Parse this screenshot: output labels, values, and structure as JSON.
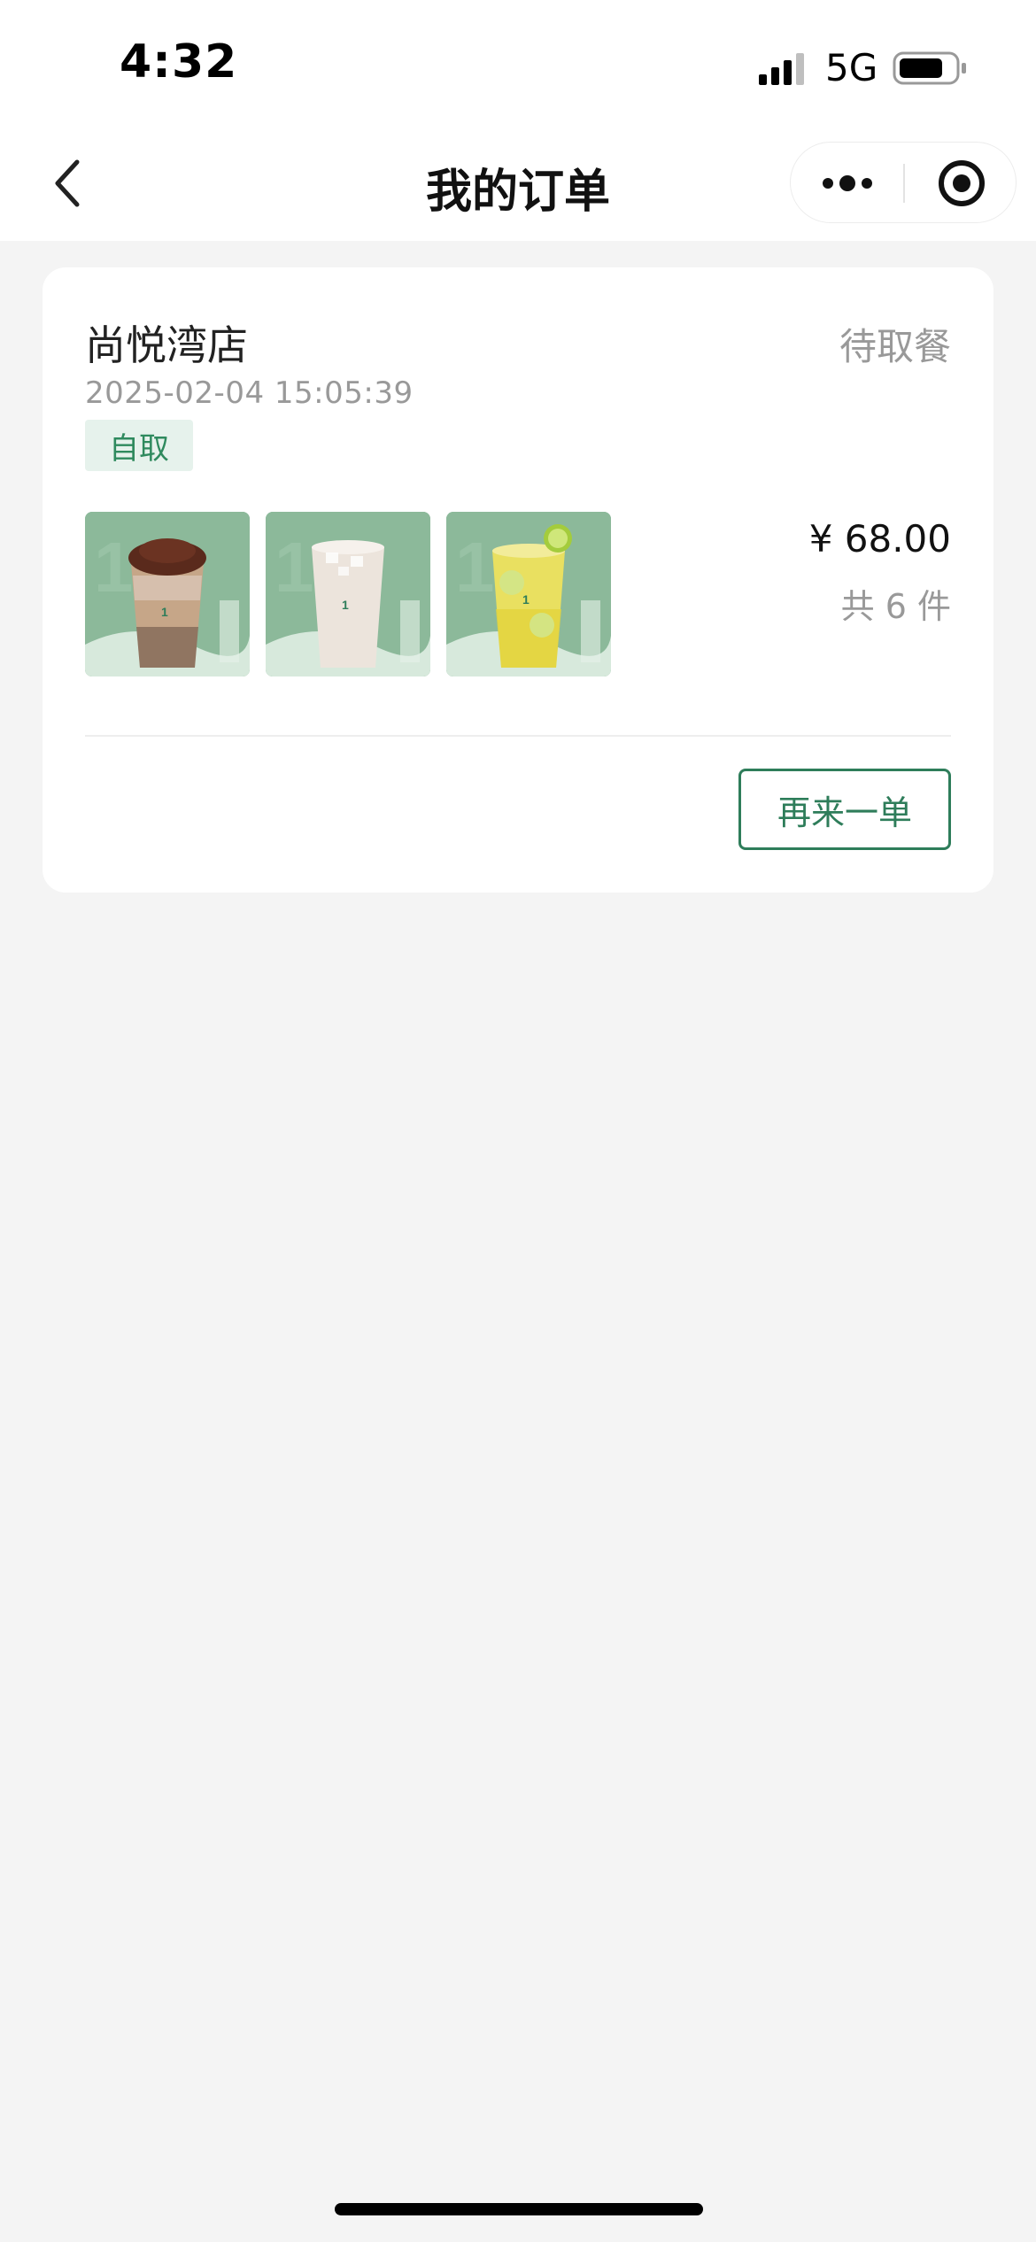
{
  "status_bar": {
    "time": "4:32",
    "network": "5G",
    "icons": [
      "signal-icon",
      "battery-icon"
    ]
  },
  "nav": {
    "title": "我的订单",
    "icons": [
      "back-arrow-icon",
      "more-dots-icon",
      "close-circle-icon"
    ]
  },
  "order": {
    "store_name": "尚悦湾店",
    "status": "待取餐",
    "datetime": "2025-02-04 15:05:39",
    "pickup_tag": "自取",
    "price": "¥ 68.00",
    "item_count": "共 6 件",
    "products": [
      {
        "image": "milk-tea-with-topping-image"
      },
      {
        "image": "coconut-milk-drink-image"
      },
      {
        "image": "lime-juice-drink-image"
      }
    ],
    "reorder_label": "再来一单"
  },
  "colors": {
    "accent": "#2e7d5a",
    "badge_bg": "#e6f2ec",
    "badge_text": "#2f8a5e",
    "muted_text": "#999999",
    "page_bg": "#f4f4f4"
  }
}
